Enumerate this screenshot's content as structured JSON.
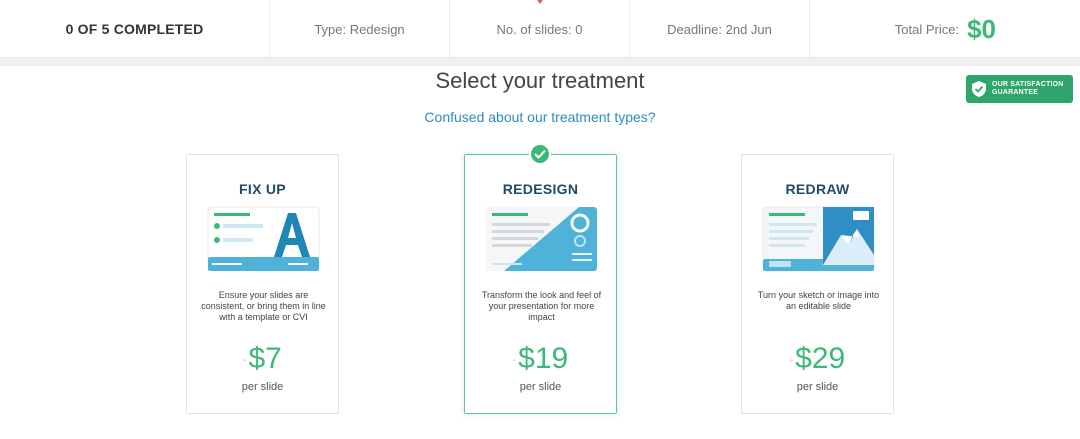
{
  "status_bar": {
    "progress": "0 OF 5 COMPLETED",
    "type": "Type: Redesign",
    "slides": "No. of slides: 0",
    "deadline": "Deadline: 2nd Jun",
    "total_label": "Total Price:",
    "total_value": "$0"
  },
  "main": {
    "heading": "Select your treatment",
    "confused_link": "Confused about our treatment types?"
  },
  "guarantee": {
    "line1": "OUR SATISFACTION",
    "line2": "GUARANTEE"
  },
  "cards": [
    {
      "title": "FIX UP",
      "desc": "Ensure your slides are consistent, or bring them in line with a template or CVI",
      "price": "$7",
      "per": "per slide",
      "icon": "fixup-illustration"
    },
    {
      "title": "REDESIGN",
      "desc": "Transform the look and feel of your presentation for more impact",
      "price": "$19",
      "per": "per slide",
      "icon": "redesign-illustration",
      "selected": true
    },
    {
      "title": "REDRAW",
      "desc": "Turn your sketch or image into an editable slide",
      "price": "$29",
      "per": "per slide",
      "icon": "redraw-illustration"
    }
  ],
  "colors": {
    "accent_green": "#3cb878",
    "link_blue": "#2e8bc0",
    "title_navy": "#1e4b66",
    "pointer_red": "#e05a4f",
    "illustration_blue": "#4fb3d9"
  }
}
